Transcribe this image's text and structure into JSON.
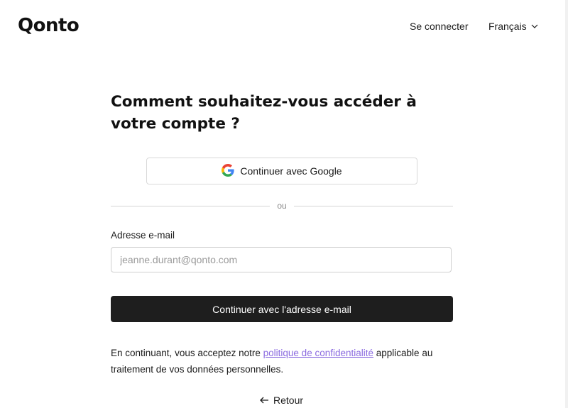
{
  "header": {
    "logo": "Qonto",
    "login_label": "Se connecter",
    "language_label": "Français",
    "language_icon": "chevron-down-icon"
  },
  "main": {
    "title": "Comment souhaitez-vous accéder à votre compte ?",
    "google_button_label": "Continuer avec Google",
    "google_icon": "google-icon",
    "divider_label": "ou",
    "email_label": "Adresse e-mail",
    "email_placeholder": "jeanne.durant@qonto.com",
    "email_value": "",
    "submit_label": "Continuer avec l'adresse e-mail",
    "consent_before": "En continuant, vous acceptez notre ",
    "consent_link": "politique de confidentialité",
    "consent_after": " applicable au traitement de vos données personnelles.",
    "back_label": "Retour",
    "back_icon": "arrow-left-icon"
  },
  "colors": {
    "primary_button": "#1e1e1e",
    "link": "#8b6be0",
    "text": "#1b1b1b"
  }
}
